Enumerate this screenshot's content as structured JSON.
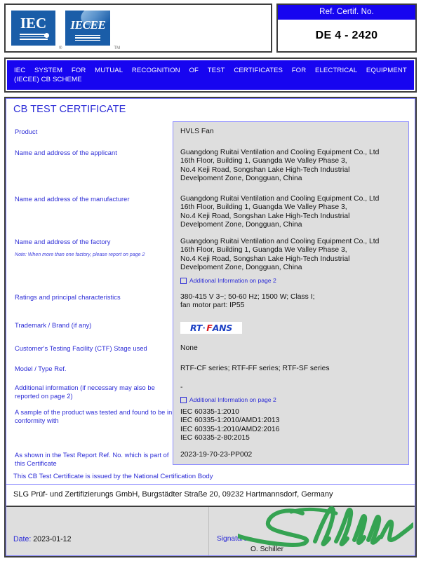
{
  "header": {
    "logos": [
      {
        "name": "iec-logo",
        "text": "IEC",
        "mark": "®"
      },
      {
        "name": "iecee-logo",
        "text": "IECEE",
        "mark": "TM"
      }
    ],
    "ref_label": "Ref. Certif. No.",
    "ref_value": "DE 4 - 2420"
  },
  "banner": {
    "line1_words": [
      "IEC",
      "SYSTEM",
      "FOR",
      "MUTUAL",
      "RECOGNITION",
      "OF",
      "TEST",
      "CERTIFICATES",
      "FOR",
      "ELECTRICAL",
      "EQUIPMENT"
    ],
    "line1": "IEC SYSTEM FOR MUTUAL RECOGNITION OF TEST CERTIFICATES FOR ELECTRICAL EQUIPMENT",
    "line2": "(IECEE) CB SCHEME"
  },
  "certificate": {
    "title": "CB TEST CERTIFICATE",
    "labels": {
      "product": "Product",
      "applicant": "Name and address of the applicant",
      "manufacturer": "Name and address of the manufacturer",
      "factory": "Name and address of the factory",
      "factory_note": "Note: When more than one factory, please report on page 2",
      "ratings": "Ratings and principal characteristics",
      "trademark": "Trademark / Brand (if any)",
      "ctf": "Customer's Testing Facility (CTF) Stage used",
      "model": "Model / Type Ref.",
      "additional": "Additional information (if necessary may also be reported on page 2)",
      "conformity": "A sample of the product was tested and found to be in conformity with",
      "testreport": "As shown in the Test Report Ref. No. which is part of this Certificate"
    },
    "values": {
      "product": "HVLS Fan",
      "applicant_address": "Guangdong Ruitai Ventilation and Cooling Equipment Co., Ltd\n16th Floor, Building 1, Guangda We Valley Phase 3,\nNo.4 Keji Road, Songshan Lake High-Tech Industrial\nDevelpoment Zone, Dongguan, China",
      "manufacturer_address": "Guangdong Ruitai Ventilation and Cooling Equipment Co., Ltd\n16th Floor, Building 1, Guangda We Valley Phase 3,\nNo.4 Keji Road, Songshan Lake High-Tech Industrial\nDevelpoment Zone, Dongguan, China",
      "factory_address": "Guangdong Ruitai Ventilation and Cooling Equipment Co., Ltd\n16th Floor, Building 1, Guangda We Valley Phase 3,\nNo.4 Keji Road, Songshan Lake High-Tech Industrial\nDevelpoment Zone, Dongguan, China",
      "factory_additional_info": "Additional Information on page 2",
      "ratings": "380-415 V 3~; 50-60 Hz; 1500 W; Class I;\nfan motor part: IP55",
      "trademark_rt": "RT",
      "trademark_sep": "·",
      "trademark_f": "F",
      "trademark_ans": "ANS",
      "ctf": "None",
      "model": "RTF-CF series; RTF-FF series; RTF-SF series",
      "additional": "-",
      "additional_info_link": "Additional Information on page 2",
      "conformity": "IEC 60335-1:2010\nIEC 60335-1:2010/AMD1:2013\nIEC 60335-1:2010/AMD2:2016\nIEC 60335-2-80:2015",
      "testreport": "2023-19-70-23-PP002"
    }
  },
  "footer": {
    "issued_by": "This CB Test Certificate is issued by the National Certification Body",
    "ncb_name": "SLG Prüf- und Zertifizierungs GmbH, Burgstädter Straße 20, 09232 Hartmannsdorf, Germany",
    "date_label": "Date:",
    "date_value": "2023-01-12",
    "signature_label": "Signature:",
    "signer_name": "O. Schiller"
  },
  "colors": {
    "brand_blue": "#1705f0",
    "label_blue": "#2b2bd6",
    "logo_blue": "#1a5da8",
    "panel_grey": "#dedede",
    "signature_green": "#35a352",
    "brand_red": "#d81a20"
  }
}
